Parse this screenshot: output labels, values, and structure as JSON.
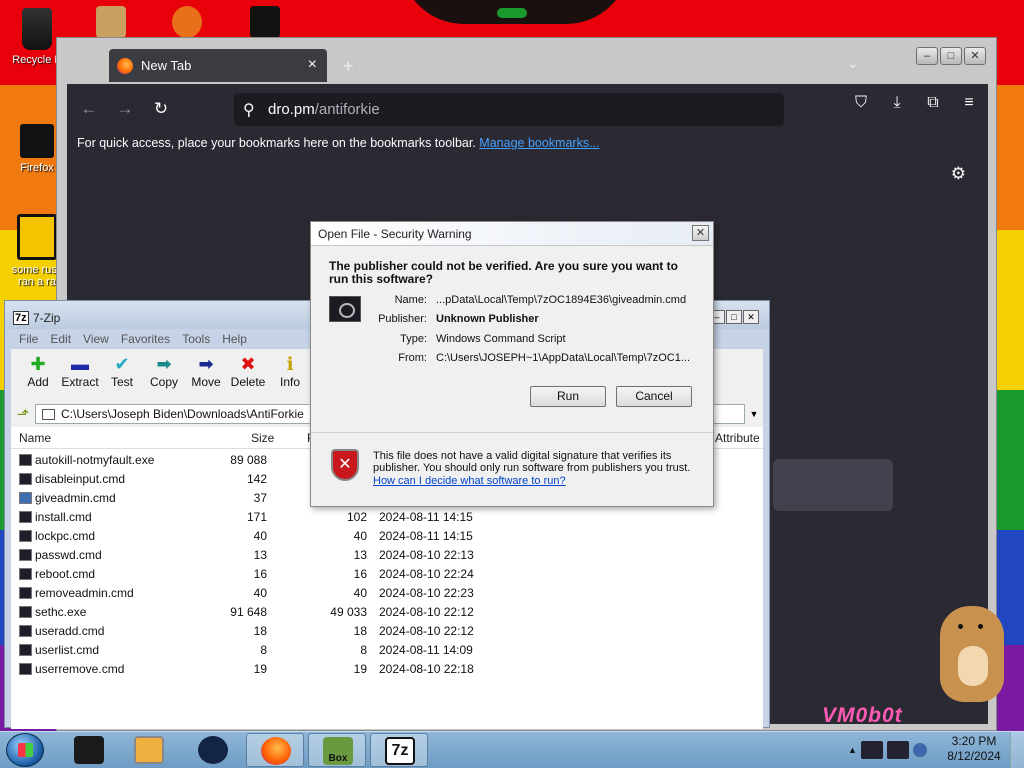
{
  "desktop": {
    "icons": [
      {
        "label": "Recycle B"
      },
      {
        "label": "Firefox"
      },
      {
        "label": "some russ\nran a ra"
      }
    ],
    "watermark": "VM0b0t"
  },
  "browser": {
    "tab_title": "New Tab",
    "url_host": "dro.pm",
    "url_path": "/antiforkie",
    "bookmarks_hint": "For quick access, place your bookmarks here on the bookmarks toolbar.",
    "manage_bookmarks": "Manage bookmarks..."
  },
  "sevenzip": {
    "title": "7-Zip",
    "logo": "7z",
    "menu": [
      "File",
      "Edit",
      "View",
      "Favorites",
      "Tools",
      "Help"
    ],
    "toolbar": [
      "Add",
      "Extract",
      "Test",
      "Copy",
      "Move",
      "Delete",
      "Info"
    ],
    "path": "C:\\Users\\Joseph Biden\\Downloads\\AntiForkie",
    "columns": {
      "name": "Name",
      "size": "Size",
      "packed": "P",
      "attributes": "Attribute"
    },
    "rows": [
      {
        "name": "autokill-notmyfault.exe",
        "size": "89 088",
        "packed": "",
        "modified": ""
      },
      {
        "name": "disableinput.cmd",
        "size": "142",
        "packed": "",
        "modified": ""
      },
      {
        "name": "giveadmin.cmd",
        "size": "37",
        "packed": "",
        "modified": ""
      },
      {
        "name": "install.cmd",
        "size": "171",
        "packed": "102",
        "modified": "2024-08-11 14:15"
      },
      {
        "name": "lockpc.cmd",
        "size": "40",
        "packed": "40",
        "modified": "2024-08-11 14:15"
      },
      {
        "name": "passwd.cmd",
        "size": "13",
        "packed": "13",
        "modified": "2024-08-10 22:13"
      },
      {
        "name": "reboot.cmd",
        "size": "16",
        "packed": "16",
        "modified": "2024-08-10 22:24"
      },
      {
        "name": "removeadmin.cmd",
        "size": "40",
        "packed": "40",
        "modified": "2024-08-10 22:23"
      },
      {
        "name": "sethc.exe",
        "size": "91 648",
        "packed": "49 033",
        "modified": "2024-08-10 22:12"
      },
      {
        "name": "useradd.cmd",
        "size": "18",
        "packed": "18",
        "modified": "2024-08-10 22:12"
      },
      {
        "name": "userlist.cmd",
        "size": "8",
        "packed": "8",
        "modified": "2024-08-11 14:09"
      },
      {
        "name": "userremove.cmd",
        "size": "19",
        "packed": "19",
        "modified": "2024-08-10 22:18"
      }
    ]
  },
  "dialog": {
    "title": "Open File - Security Warning",
    "headline": "The publisher could not be verified.  Are you sure you want to run this software?",
    "fields": [
      {
        "label": "Name:",
        "value": "...pData\\Local\\Temp\\7zOC1894E36\\giveadmin.cmd",
        "bold": false
      },
      {
        "label": "Publisher:",
        "value": "Unknown Publisher",
        "bold": true
      },
      {
        "label": "Type:",
        "value": "Windows Command Script",
        "bold": false
      },
      {
        "label": "From:",
        "value": "C:\\Users\\JOSEPH~1\\AppData\\Local\\Temp\\7zOC1...",
        "bold": false
      }
    ],
    "run_label": "Run",
    "cancel_label": "Cancel",
    "warning": "This file does not have a valid digital signature that verifies its publisher.  You should only run software from publishers you trust.",
    "help_link": "How can I decide what software to run?"
  },
  "taskbar": {
    "time": "3:20 PM",
    "date": "8/12/2024",
    "zip_label": "7z",
    "box_label": "Box"
  }
}
